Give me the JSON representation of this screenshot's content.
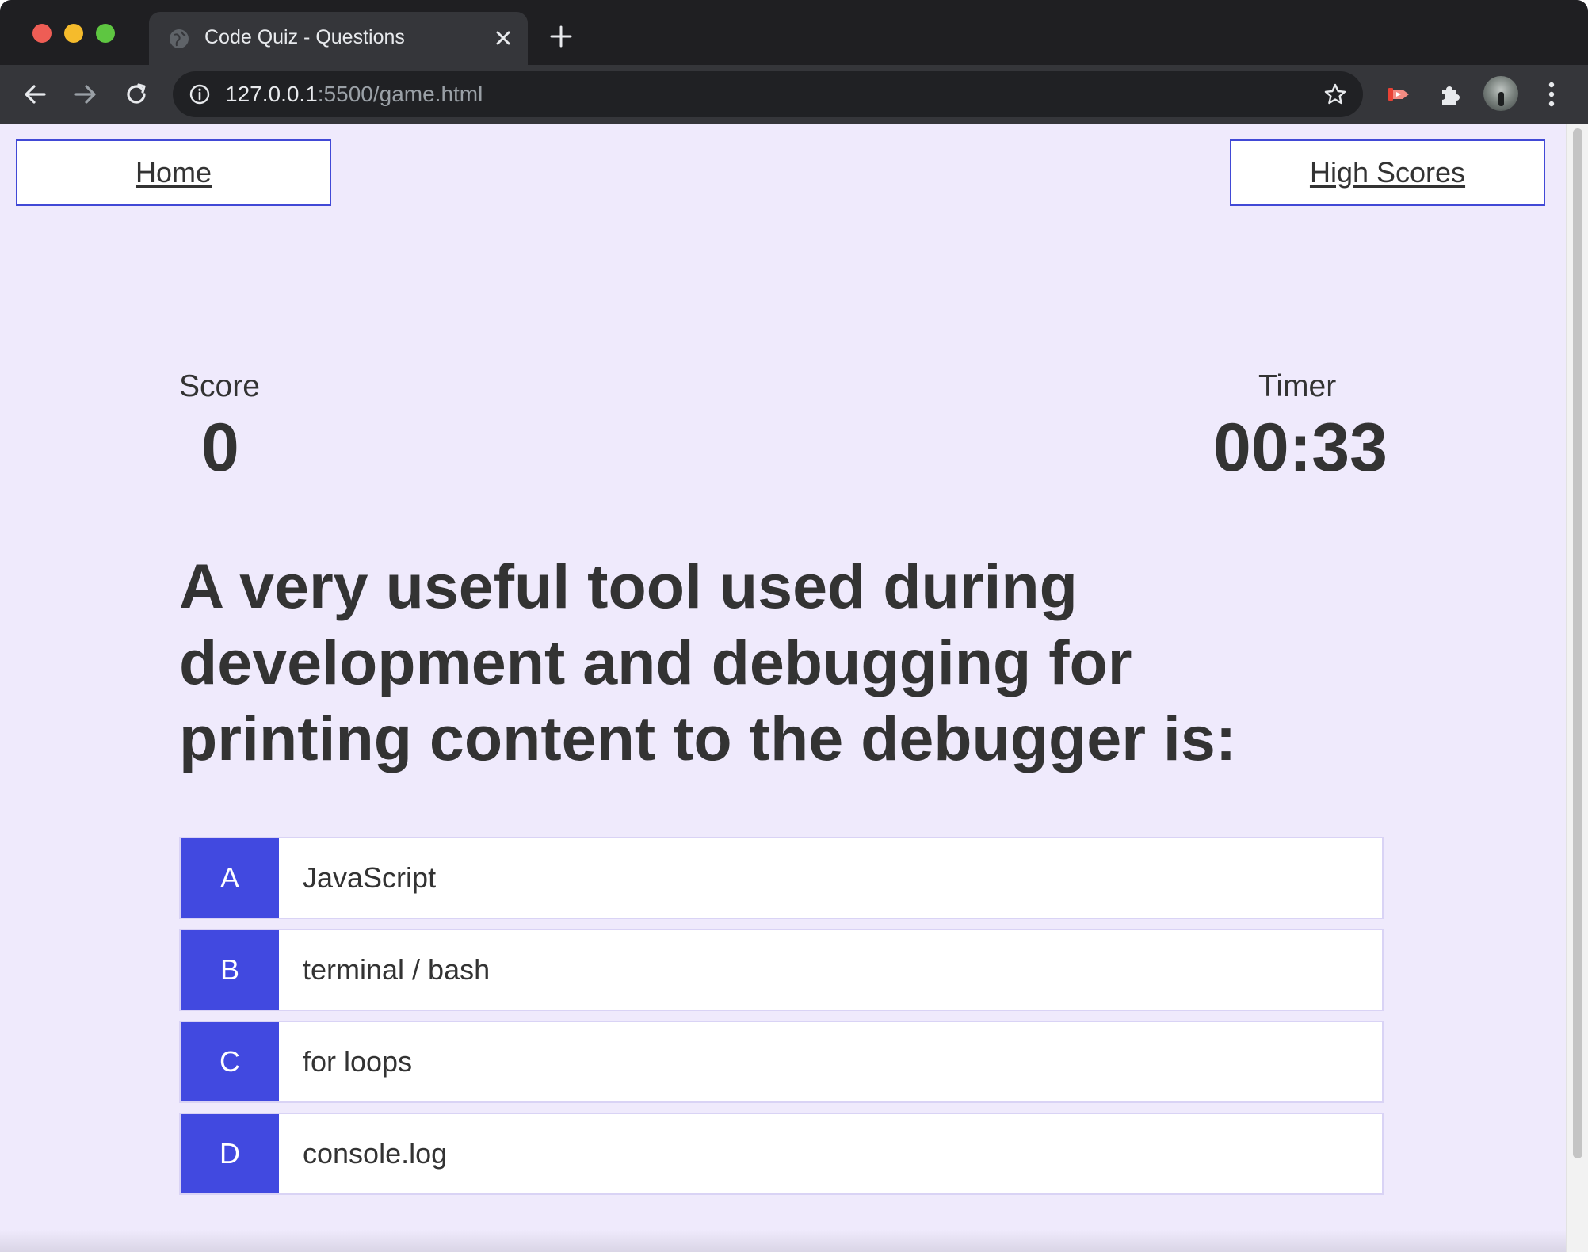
{
  "browser": {
    "tab": {
      "title": "Code Quiz - Questions"
    },
    "address": {
      "host": "127.0.0.1",
      "rest": ":5500/game.html"
    },
    "icons": {
      "back": "arrow-left-icon",
      "forward": "arrow-right-icon",
      "reload": "reload-icon",
      "info": "info-icon",
      "bookmark": "star-icon",
      "extension_cast": "cast-extension-icon",
      "extensions": "puzzle-icon",
      "profile": "avatar",
      "menu": "kebab-menu-icon",
      "new_tab": "plus-icon",
      "close_tab": "close-icon"
    },
    "colors": {
      "chrome_dark": "#1f1f22",
      "toolbar": "#35363a",
      "omnibox": "#202124"
    }
  },
  "page": {
    "nav": {
      "home_label": "Home",
      "high_scores_label": "High Scores"
    },
    "hud": {
      "score_label": "Score",
      "score_value": "0",
      "timer_label": "Timer",
      "timer_value": "00:33"
    },
    "question": "A very useful tool used during development and debugging for printing content to the debugger is:",
    "choices": [
      {
        "prefix": "A",
        "text": "JavaScript"
      },
      {
        "prefix": "B",
        "text": "terminal / bash"
      },
      {
        "prefix": "C",
        "text": "for loops"
      },
      {
        "prefix": "D",
        "text": "console.log"
      }
    ],
    "colors": {
      "background": "#efeafc",
      "accent": "#4149e0",
      "text": "#333333"
    }
  }
}
